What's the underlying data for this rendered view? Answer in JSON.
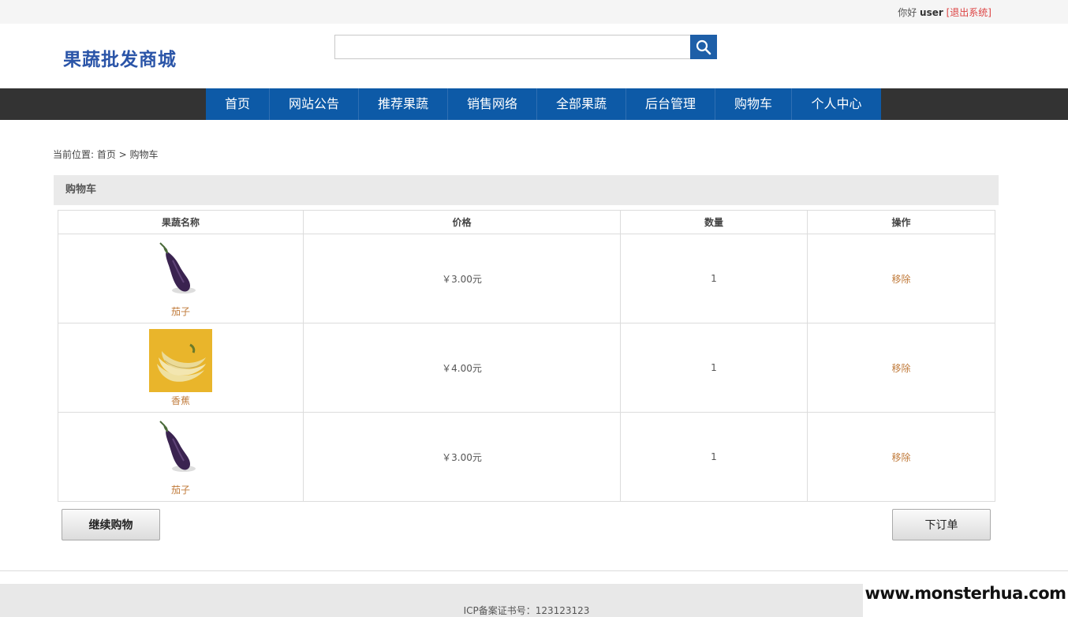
{
  "topbar": {
    "greeting": "你好",
    "username": "user",
    "logout_label": "[退出系统]"
  },
  "header": {
    "logo": "果蔬批发商城",
    "search": {
      "value": "",
      "placeholder": ""
    },
    "search_icon": "search-icon"
  },
  "nav": {
    "items": [
      {
        "label": "首页"
      },
      {
        "label": "网站公告"
      },
      {
        "label": "推荐果蔬"
      },
      {
        "label": "销售网络"
      },
      {
        "label": "全部果蔬"
      },
      {
        "label": "后台管理"
      },
      {
        "label": "购物车"
      },
      {
        "label": "个人中心"
      }
    ]
  },
  "breadcrumb": "当前位置: 首页 > 购物车",
  "panel_title": "购物车",
  "table": {
    "headers": [
      "果蔬名称",
      "价格",
      "数量",
      "操作"
    ],
    "rows": [
      {
        "image": "eggplant",
        "name": "茄子",
        "price": "￥3.00元",
        "qty": "1",
        "action": "移除"
      },
      {
        "image": "banana",
        "name": "香蕉",
        "price": "￥4.00元",
        "qty": "1",
        "action": "移除"
      },
      {
        "image": "eggplant",
        "name": "茄子",
        "price": "￥3.00元",
        "qty": "1",
        "action": "移除"
      }
    ]
  },
  "buttons": {
    "continue_label": "继续购物",
    "order_label": "下订单"
  },
  "footer": {
    "icp": "ICP备案证书号：123123123"
  },
  "watermark": "www.monsterhua.com",
  "colors": {
    "nav_blue": "#0d5aa7",
    "nav_dark": "#333333",
    "logo": "#2b55a8",
    "link": "#c07a3a"
  }
}
